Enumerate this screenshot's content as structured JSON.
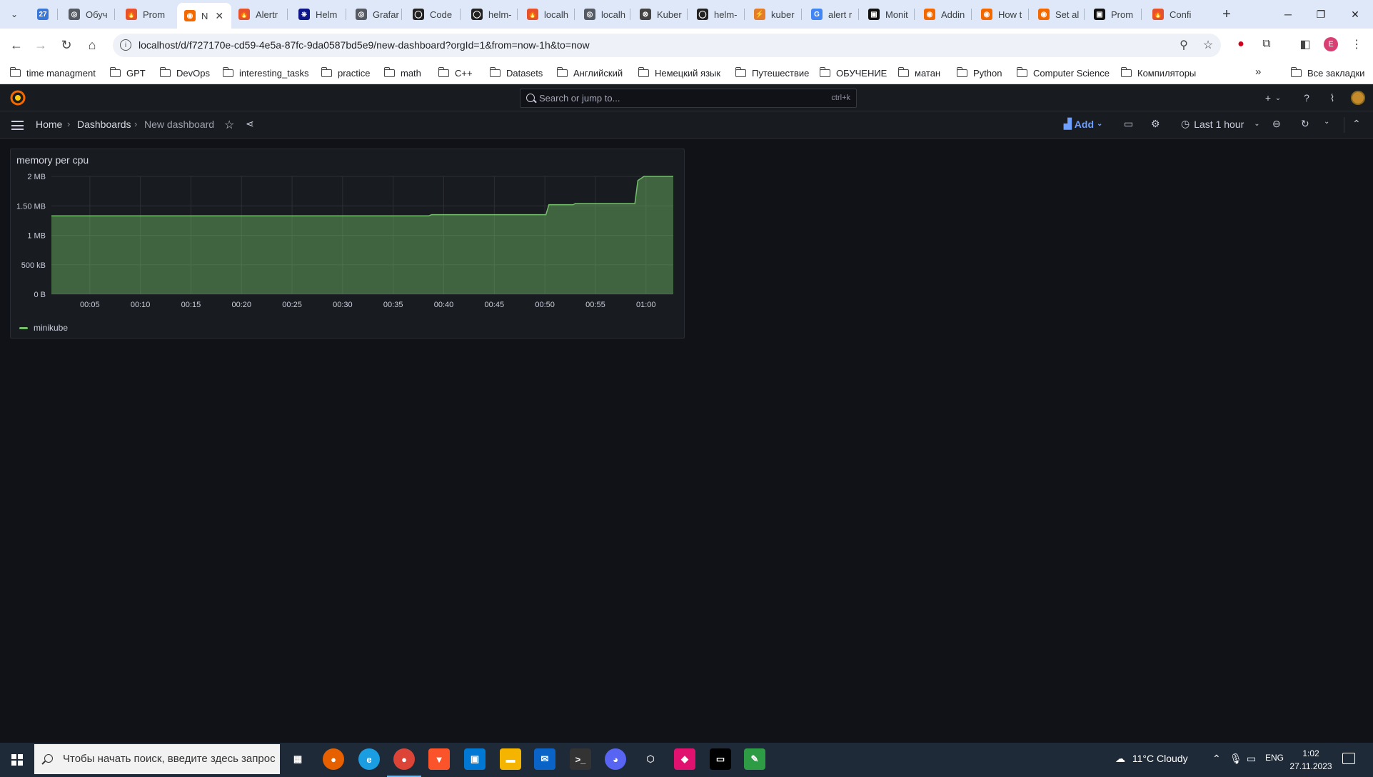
{
  "browser": {
    "tabs": [
      {
        "title": "",
        "fav_color": "#3b77d8",
        "fav": "27"
      },
      {
        "title": "Обуч",
        "fav_color": "#555a63",
        "fav": "◎"
      },
      {
        "title": "Prom",
        "fav_color": "#e6522c",
        "fav": "🔥"
      },
      {
        "title": "N",
        "fav_color": "#f46800",
        "fav": "◉",
        "active": true
      },
      {
        "title": "Alertr",
        "fav_color": "#e6522c",
        "fav": "🔥"
      },
      {
        "title": "Helm",
        "fav_color": "#0f1689",
        "fav": "⎈"
      },
      {
        "title": "Grafar",
        "fav_color": "#555a63",
        "fav": "◎"
      },
      {
        "title": "Code",
        "fav_color": "#222",
        "fav": "◯"
      },
      {
        "title": "helm-",
        "fav_color": "#222",
        "fav": "◯"
      },
      {
        "title": "localh",
        "fav_color": "#e6522c",
        "fav": "🔥"
      },
      {
        "title": "localh",
        "fav_color": "#555a63",
        "fav": "◎"
      },
      {
        "title": "Kuber",
        "fav_color": "#444",
        "fav": "⊗"
      },
      {
        "title": "helm-",
        "fav_color": "#222",
        "fav": "◯"
      },
      {
        "title": "kuber",
        "fav_color": "#e47d2a",
        "fav": "⚡"
      },
      {
        "title": "alert r",
        "fav_color": "#4285f4",
        "fav": "G"
      },
      {
        "title": "Monit",
        "fav_color": "#111",
        "fav": "▣"
      },
      {
        "title": "Addin",
        "fav_color": "#f46800",
        "fav": "◉"
      },
      {
        "title": "How t",
        "fav_color": "#f46800",
        "fav": "◉"
      },
      {
        "title": "Set al",
        "fav_color": "#f46800",
        "fav": "◉"
      },
      {
        "title": "Prom",
        "fav_color": "#111",
        "fav": "▣"
      },
      {
        "title": "Confi",
        "fav_color": "#e6522c",
        "fav": "🔥"
      }
    ],
    "url": "localhost/d/f727170e-cd59-4e5a-87fc-9da0587bd5e9/new-dashboard?orgId=1&from=now-1h&to=now",
    "profile_initial": "E",
    "bookmarks": [
      "time managment",
      "GPT",
      "DevOps",
      "interesting_tasks",
      "practice",
      "math",
      "C++",
      "Datasets",
      "Английский",
      "Немецкий язык",
      "Путешествие",
      "ОБУЧЕНИЕ",
      "матан",
      "Python",
      "Computer Science",
      "Компиляторы"
    ],
    "bookmarks_more": "»",
    "all_bookmarks": "Все закладки"
  },
  "grafana": {
    "search_placeholder": "Search or jump to...",
    "search_shortcut": "ctrl+k",
    "breadcrumb": {
      "home": "Home",
      "dashboards": "Dashboards",
      "current": "New dashboard"
    },
    "add_label": "Add",
    "time_range": "Last 1 hour"
  },
  "panel": {
    "title": "memory per cpu",
    "legend": "minikube"
  },
  "chart_data": {
    "type": "area",
    "title": "memory per cpu",
    "x_ticks": [
      "00:05",
      "00:10",
      "00:15",
      "00:20",
      "00:25",
      "00:30",
      "00:35",
      "00:40",
      "00:45",
      "00:50",
      "00:55",
      "01:00"
    ],
    "y_ticks": [
      "0 B",
      "500 kB",
      "1 MB",
      "1.50 MB",
      "2 MB"
    ],
    "ylim": [
      0,
      2
    ],
    "yunit": "MB",
    "x_range_minutes": [
      1.2,
      62.7
    ],
    "series": [
      {
        "name": "minikube",
        "color": "#73bf69",
        "x": [
          1.2,
          38.5,
          38.8,
          50.1,
          50.4,
          52.8,
          53.0,
          58.9,
          59.2,
          59.8,
          62.7
        ],
        "y": [
          1.33,
          1.33,
          1.35,
          1.35,
          1.52,
          1.52,
          1.54,
          1.54,
          1.93,
          2.0,
          2.0
        ]
      }
    ]
  },
  "taskbar": {
    "search_placeholder": "Чтобы начать поиск, введите здесь запрос",
    "weather": "11°C  Cloudy",
    "lang": "ENG",
    "time": "1:02",
    "date": "27.11.2023"
  }
}
